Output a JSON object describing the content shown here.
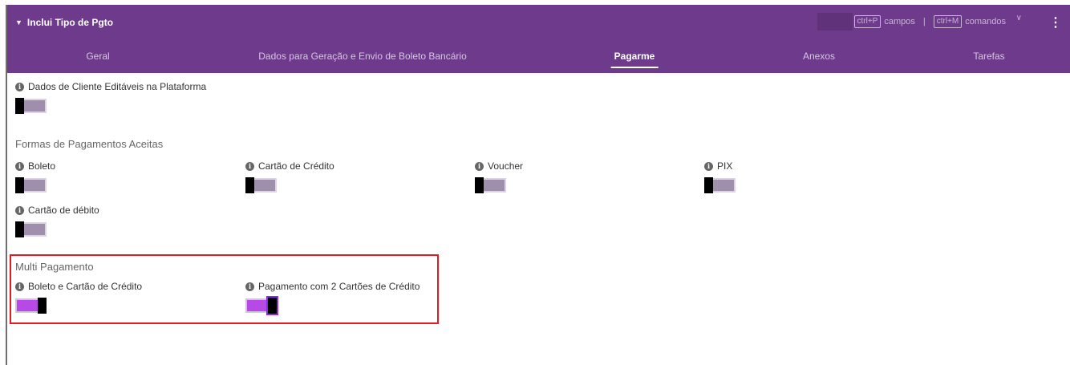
{
  "header": {
    "title": "Inclui Tipo de Pgto",
    "caret_icon": "caret-down-icon",
    "shortcut_fields_key": "ctrl+P",
    "shortcut_fields_label": "campos",
    "separator": "|",
    "shortcut_commands_key": "ctrl+M",
    "shortcut_commands_label": "comandos",
    "chevron_icon": "chevron-down-icon",
    "menu_icon": "kebab-menu-icon"
  },
  "tabs": [
    {
      "label": "Geral",
      "active": false
    },
    {
      "label": "Dados para Geração e Envio de Boleto Bancário",
      "active": false
    },
    {
      "label": "Pagarme",
      "active": true
    },
    {
      "label": "Anexos",
      "active": false
    },
    {
      "label": "Tarefas",
      "active": false
    }
  ],
  "fields": {
    "editable_client": {
      "label": "Dados de Cliente Editáveis na Plataforma",
      "on": false
    },
    "boleto": {
      "label": "Boleto",
      "on": false
    },
    "cartao_credito": {
      "label": "Cartão de Crédito",
      "on": false
    },
    "voucher": {
      "label": "Voucher",
      "on": false
    },
    "pix": {
      "label": "PIX",
      "on": false
    },
    "cartao_debito": {
      "label": "Cartão de débito",
      "on": false
    },
    "boleto_cartao": {
      "label": "Boleto e Cartão de Crédito",
      "on": true
    },
    "dois_cartoes": {
      "label": "Pagamento com 2 Cartões de Crédito",
      "on": true
    }
  },
  "sections": {
    "formas": "Formas de Pagamentos Aceitas",
    "multi": "Multi Pagamento"
  },
  "colors": {
    "header_bg": "#6d3a8c",
    "toggle_on": "#b74ae6",
    "toggle_off": "#9f8fad",
    "highlight": "#e31b23"
  }
}
